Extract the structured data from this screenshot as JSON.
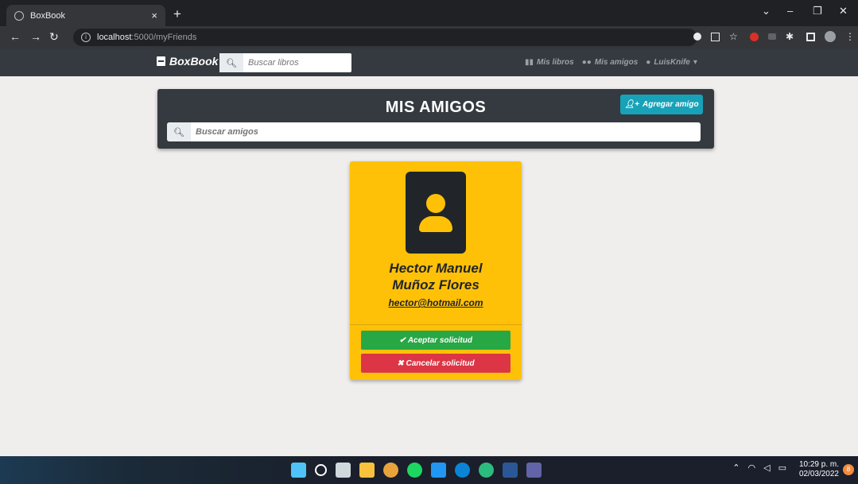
{
  "browser": {
    "tab_title": "BoxBook",
    "tab_close": "×",
    "new_tab": "+",
    "url_host": "localhost",
    "url_path": ":5000/myFriends"
  },
  "navbar": {
    "brand": "BoxBook",
    "search_placeholder": "Buscar libros",
    "links": [
      "Mis libros",
      "Mis amigos",
      "LuisKnife"
    ]
  },
  "page": {
    "title": "MIS AMIGOS",
    "add_button_label": "Agregar amigo",
    "search_placeholder": "Buscar amigos"
  },
  "friend_card": {
    "name": "Hector Manuel Muñoz Flores",
    "email": "hector@hotmail.com",
    "accept_label": "✔ Aceptar solicitud",
    "cancel_label": "✖ Cancelar solicitud"
  },
  "taskbar": {
    "time": "10:29 p. m.",
    "date": "02/03/2022",
    "notification_count": "8"
  },
  "colors": {
    "navbar": "#343a40",
    "card": "#ffc107",
    "accept": "#28a745",
    "cancel": "#dc3545",
    "info": "#17a2b8"
  }
}
